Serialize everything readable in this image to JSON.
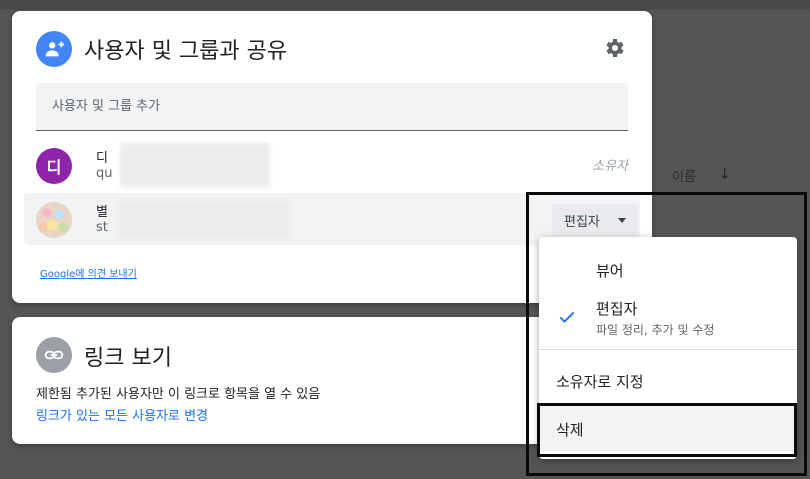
{
  "background": {
    "column_header": "이름",
    "sort_icon": "arrow-down-icon"
  },
  "share_dialog": {
    "title": "사용자 및 그룹과 공유",
    "settings_icon": "gear-icon",
    "add_people_placeholder": "사용자 및 그룹 추가",
    "people": [
      {
        "avatar_letter": "디",
        "name": "디",
        "email": "qu",
        "role": "소유자",
        "avatar_color": "#8e24aa"
      },
      {
        "avatar_letter": "",
        "name": "별",
        "email": "st",
        "role": "편집자"
      }
    ],
    "feedback_link_brand": "Google",
    "feedback_link_text": "에 의견 보내기"
  },
  "link_dialog": {
    "title": "링크 보기",
    "description": "제한됨 추가된 사용자만 이 링크로 항목을 열 수 있음",
    "change_link": "링크가 있는 모든 사용자로 변경"
  },
  "role_menu": {
    "items": [
      {
        "label": "뷰어",
        "sublabel": "",
        "selected": false
      },
      {
        "label": "편집자",
        "sublabel": "파일 정리, 추가 및 수정",
        "selected": true
      },
      {
        "label": "소유자로 지정",
        "sublabel": "",
        "selected": false
      },
      {
        "label": "삭제",
        "sublabel": "",
        "selected": false
      }
    ]
  },
  "colors": {
    "accent": "#1a73e8",
    "share_icon_bg": "#4285f4",
    "link_icon_bg": "#9aa0a6",
    "highlight_border": "#0a0a0a"
  }
}
